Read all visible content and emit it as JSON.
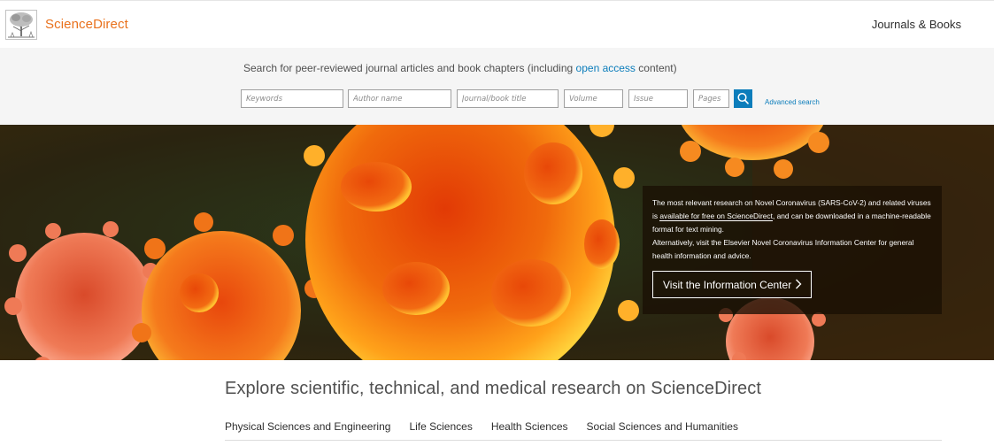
{
  "header": {
    "brand": "ScienceDirect",
    "journals_link": "Journals & Books"
  },
  "search": {
    "intro_before": "Search for peer-reviewed journal articles and book chapters (including ",
    "intro_link": "open access",
    "intro_after": " content)",
    "placeholders": {
      "keywords": "Keywords",
      "author": "Author name",
      "journal": "Journal/book title",
      "volume": "Volume",
      "issue": "Issue",
      "pages": "Pages"
    },
    "advanced": "Advanced search"
  },
  "hero": {
    "line1": "The most relevant research on Novel Coronavirus (SARS-CoV-2) and related viruses is ",
    "free_link": "available for free on ScienceDirect",
    "line1_end": ", and can be downloaded in a machine-readable format for text mining.",
    "line2": "Alternatively, visit the Elsevier Novel Coronavirus Information Center for general health information and advice.",
    "button": "Visit the Information Center"
  },
  "explore": {
    "title": "Explore scientific, technical, and medical research on ScienceDirect",
    "subjects": [
      "Physical Sciences and Engineering",
      "Life Sciences",
      "Health Sciences",
      "Social Sciences and Humanities"
    ]
  },
  "colors": {
    "brand": "#e9711c",
    "link": "#0c7dbb"
  }
}
